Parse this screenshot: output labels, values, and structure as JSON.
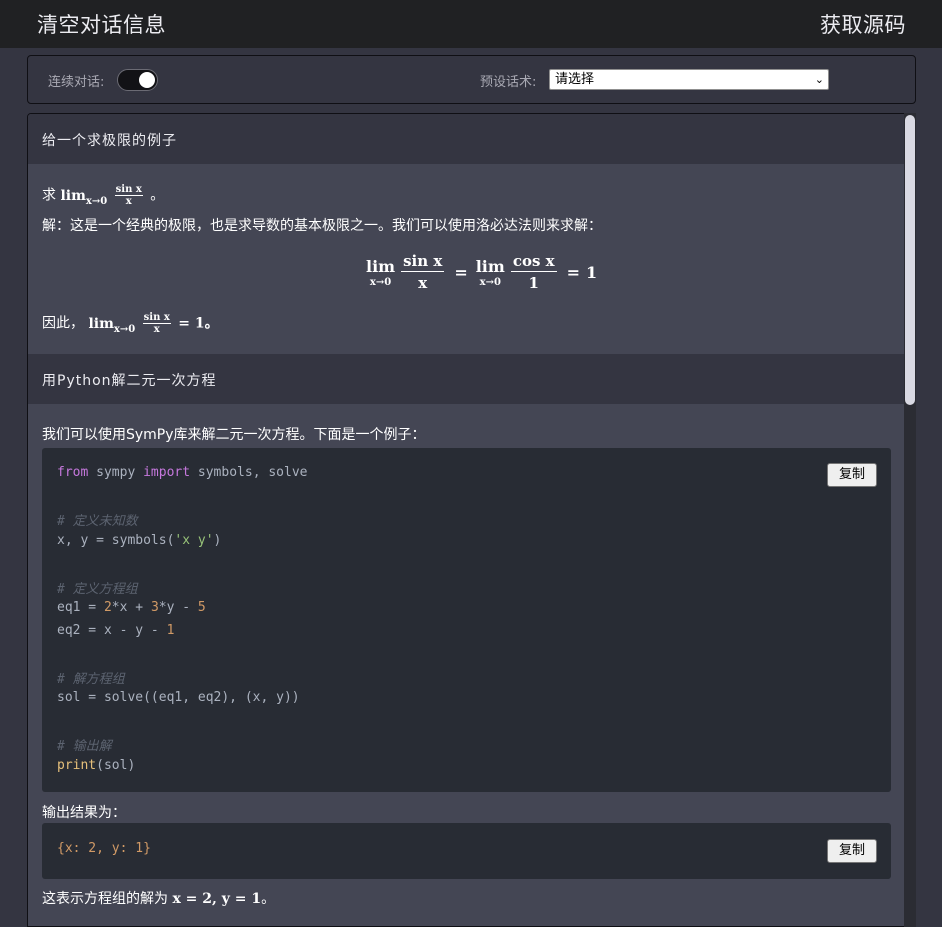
{
  "header": {
    "clear_label": "清空对话信息",
    "source_label": "获取源码"
  },
  "settings": {
    "continuous_label": "连续对话:",
    "continuous_on": true,
    "preset_label": "预设话术:",
    "preset_value": "请选择"
  },
  "chat": {
    "q1": "给一个求极限的例子",
    "a1": {
      "line1_prefix": "求",
      "lim": "lim",
      "lim_sub": "x→0",
      "frac_num": "sin x",
      "frac_den": "x",
      "period": "。",
      "line2": "解：这是一个经典的极限，也是求导数的基本极限之一。我们可以使用洛必达法则来求解：",
      "display_lhs_num": "sin x",
      "display_lhs_den": "x",
      "display_rhs_num": "cos x",
      "display_rhs_den": "1",
      "eq": "=",
      "one": "1",
      "line3_prefix": "因此，",
      "line3_result": "= 1。"
    },
    "q2": "用Python解二元一次方程",
    "a2": {
      "intro": "我们可以使用SymPy库来解二元一次方程。下面是一个例子：",
      "copy_label": "复制",
      "output_label": "输出结果为：",
      "output_code": "{x: 2, y: 1}",
      "conclusion_prefix": "这表示方程组的解为 ",
      "conclusion_math": "x = 2, y = 1",
      "conclusion_suffix": "。"
    }
  }
}
